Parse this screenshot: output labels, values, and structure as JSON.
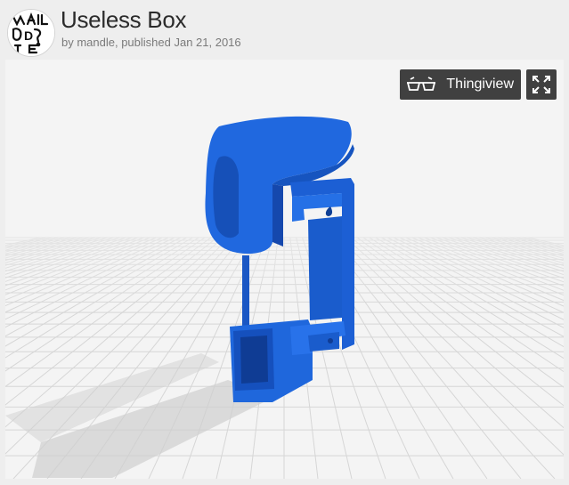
{
  "thing": {
    "title": "Useless Box",
    "byline": "by mandle, published Jan 21, 2016"
  },
  "viewer": {
    "thingiview_label": "Thingiview",
    "thingiview_icon": "3d-glasses-icon",
    "fullscreen_icon": "fullscreen-expand-icon",
    "model_color": "#1e64d8",
    "grid_color": "#d6d6d6"
  },
  "avatar": {
    "icon": "user-avatar-icon",
    "letters": [
      "M",
      "A",
      "D",
      "E",
      "?"
    ]
  }
}
